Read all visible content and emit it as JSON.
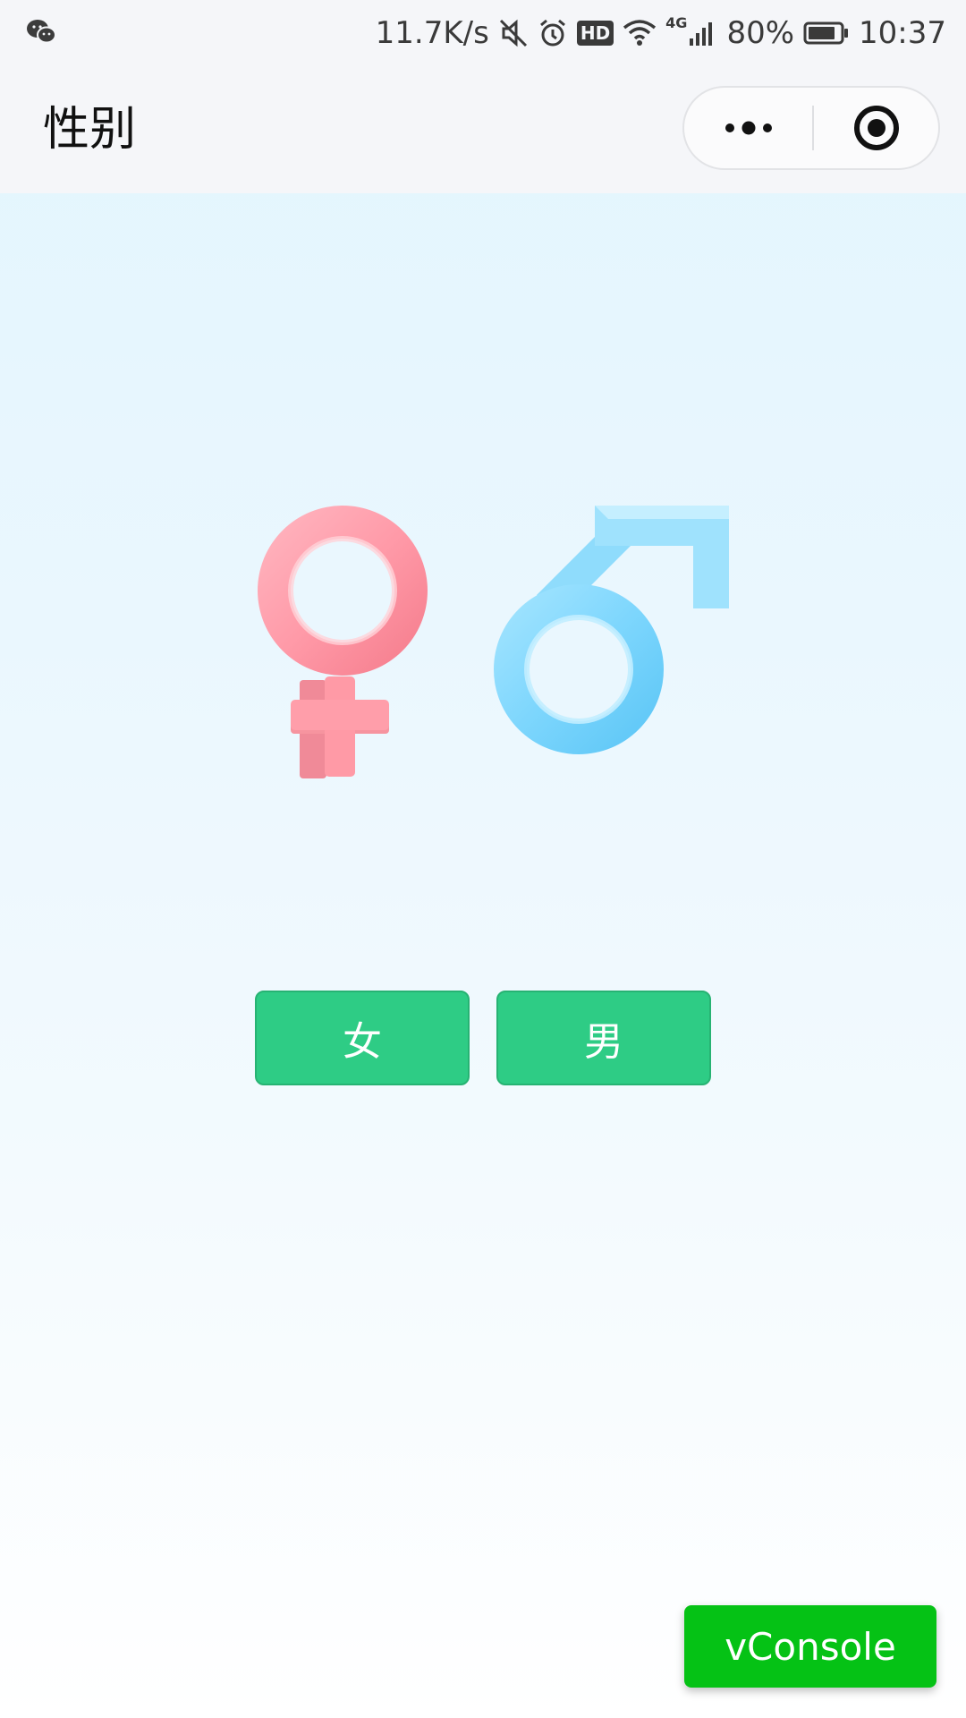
{
  "status_bar": {
    "network_speed": "11.7K/s",
    "hd_badge": "HD",
    "network_type": "4G",
    "battery_percent": "80%",
    "time": "10:37",
    "icons": [
      "wechat-icon",
      "mute-icon",
      "alarm-icon",
      "hd-icon",
      "wifi-icon",
      "signal-icon",
      "battery-icon"
    ]
  },
  "nav": {
    "title": "性别",
    "more_icon": "more-dots-icon",
    "close_icon": "target-close-icon"
  },
  "illustration": {
    "icons": [
      "female-symbol-icon",
      "male-symbol-icon"
    ],
    "colors": {
      "female": "#ff8e9c",
      "male": "#6fd0fb"
    }
  },
  "choices": {
    "female_label": "女",
    "male_label": "男",
    "button_color": "#2ecc85"
  },
  "vconsole": {
    "label": "vConsole",
    "color": "#05c215"
  }
}
